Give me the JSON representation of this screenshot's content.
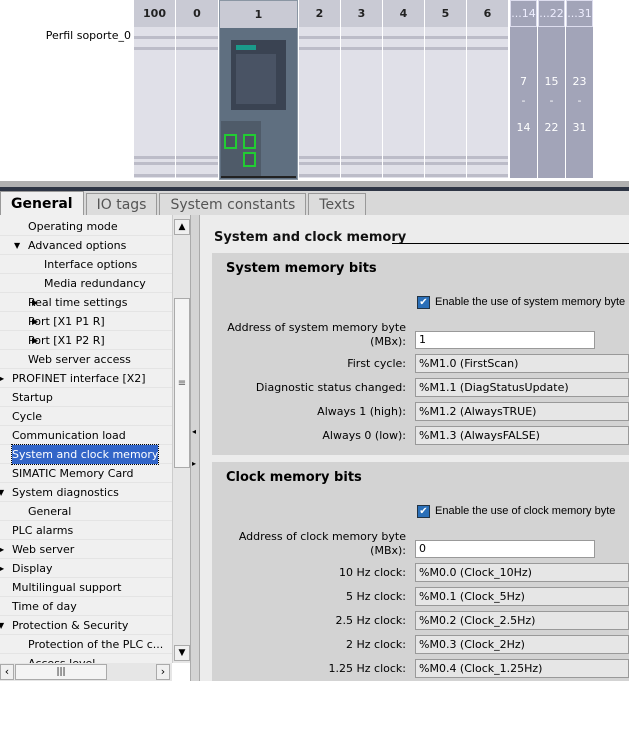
{
  "rack": {
    "label": "Perfil soporte_0",
    "slots": [
      "100",
      "0",
      "1",
      "2",
      "3",
      "4",
      "5",
      "6"
    ],
    "groups": [
      {
        "header": "...14",
        "from": "7",
        "to": "14"
      },
      {
        "header": "...22",
        "from": "15",
        "to": "22"
      },
      {
        "header": "...31",
        "from": "23",
        "to": "31"
      }
    ],
    "port_color": "#22cc33"
  },
  "tabs": [
    "General",
    "IO tags",
    "System constants",
    "Texts"
  ],
  "nav": [
    {
      "label": "Operating mode",
      "level": 2,
      "arrow": ""
    },
    {
      "label": "Advanced options",
      "level": 1,
      "arrow": "down"
    },
    {
      "label": "Interface options",
      "level": 3,
      "arrow": ""
    },
    {
      "label": "Media redundancy",
      "level": 3,
      "arrow": ""
    },
    {
      "label": "Real time settings",
      "level": 2,
      "arrow": "right"
    },
    {
      "label": "Port [X1 P1 R]",
      "level": 2,
      "arrow": "right"
    },
    {
      "label": "Port [X1 P2 R]",
      "level": 2,
      "arrow": "right"
    },
    {
      "label": "Web server access",
      "level": 2,
      "arrow": ""
    },
    {
      "label": "PROFINET interface [X2]",
      "level": 0,
      "arrow": "right"
    },
    {
      "label": "Startup",
      "level": 0,
      "arrow": ""
    },
    {
      "label": "Cycle",
      "level": 0,
      "arrow": ""
    },
    {
      "label": "Communication load",
      "level": 0,
      "arrow": ""
    },
    {
      "label": "System and clock memory",
      "level": 0,
      "arrow": "",
      "selected": true
    },
    {
      "label": "SIMATIC Memory Card",
      "level": 0,
      "arrow": ""
    },
    {
      "label": "System diagnostics",
      "level": 0,
      "arrow": "down"
    },
    {
      "label": "General",
      "level": 2,
      "arrow": ""
    },
    {
      "label": "PLC alarms",
      "level": 0,
      "arrow": ""
    },
    {
      "label": "Web server",
      "level": 0,
      "arrow": "right"
    },
    {
      "label": "Display",
      "level": 0,
      "arrow": "right"
    },
    {
      "label": "Multilingual support",
      "level": 0,
      "arrow": ""
    },
    {
      "label": "Time of day",
      "level": 0,
      "arrow": ""
    },
    {
      "label": "Protection & Security",
      "level": 0,
      "arrow": "down"
    },
    {
      "label": "Protection of the PLC c...",
      "level": 2,
      "arrow": ""
    },
    {
      "label": "Access level",
      "level": 2,
      "arrow": ""
    }
  ],
  "panel": {
    "title": "System and clock memory",
    "system": {
      "heading": "System memory bits",
      "enable_label": "Enable the use of system memory byte",
      "enabled": true,
      "address_label_1": "Address of system memory byte",
      "address_label_2": "(MBx):",
      "address_value": "1",
      "rows": [
        {
          "label": "First cycle:",
          "value": "%M1.0 (FirstScan)"
        },
        {
          "label": "Diagnostic status changed:",
          "value": "%M1.1 (DiagStatusUpdate)"
        },
        {
          "label": "Always 1 (high):",
          "value": "%M1.2 (AlwaysTRUE)"
        },
        {
          "label": "Always 0 (low):",
          "value": "%M1.3 (AlwaysFALSE)"
        }
      ]
    },
    "clock": {
      "heading": "Clock memory bits",
      "enable_label": "Enable the use of clock memory byte",
      "enabled": true,
      "address_label_1": "Address of clock memory byte",
      "address_label_2": "(MBx):",
      "address_value": "0",
      "rows": [
        {
          "label": "10 Hz clock:",
          "value": "%M0.0 (Clock_10Hz)"
        },
        {
          "label": "5 Hz clock:",
          "value": "%M0.1 (Clock_5Hz)"
        },
        {
          "label": "2.5 Hz clock:",
          "value": "%M0.2 (Clock_2.5Hz)"
        },
        {
          "label": "2 Hz clock:",
          "value": "%M0.3 (Clock_2Hz)"
        },
        {
          "label": "1.25 Hz clock:",
          "value": "%M0.4 (Clock_1.25Hz)"
        }
      ]
    }
  }
}
